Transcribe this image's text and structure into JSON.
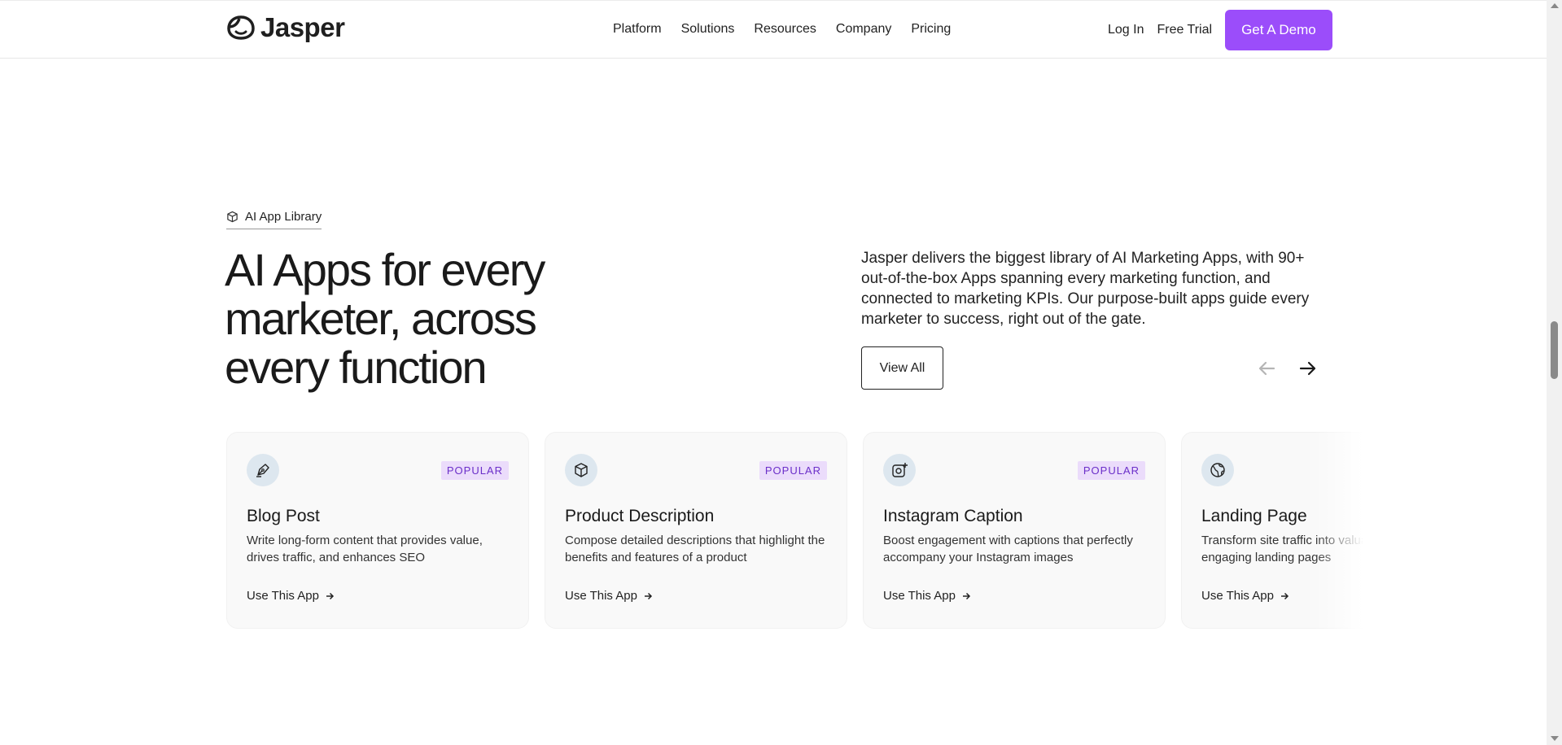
{
  "header": {
    "logo_text": "Jasper",
    "nav": [
      "Platform",
      "Solutions",
      "Resources",
      "Company",
      "Pricing"
    ],
    "login": "Log In",
    "free_trial": "Free Trial",
    "demo": "Get A Demo",
    "accent_color": "#9b4dfa"
  },
  "hero": {
    "eyebrow": "AI App Library",
    "eyebrow_icon": "cube-icon",
    "headline": "AI Apps for every marketer, across every function",
    "description": "Jasper delivers the biggest library of AI Marketing Apps, with 90+ out-of-the-box Apps spanning every marketing function, and connected to marketing KPIs. Our purpose-built apps guide every marketer to success, right out of the gate.",
    "view_all": "View All"
  },
  "cards": [
    {
      "icon": "pen-nib-icon",
      "badge": "POPULAR",
      "title": "Blog Post",
      "desc": "Write long-form content that provides value, drives traffic, and enhances SEO",
      "link": "Use This App"
    },
    {
      "icon": "cube-icon",
      "badge": "POPULAR",
      "title": "Product Description",
      "desc": "Compose detailed descriptions that highlight the benefits and features of a product",
      "link": "Use This App"
    },
    {
      "icon": "instagram-add-icon",
      "badge": "POPULAR",
      "title": "Instagram Caption",
      "desc": "Boost engagement with captions that perfectly accompany your Instagram images",
      "link": "Use This App"
    },
    {
      "icon": "globe-icon",
      "badge": "",
      "title": "Landing Page",
      "desc": "Transform site traffic into valuable leads with engaging landing pages",
      "link": "Use This App"
    }
  ]
}
